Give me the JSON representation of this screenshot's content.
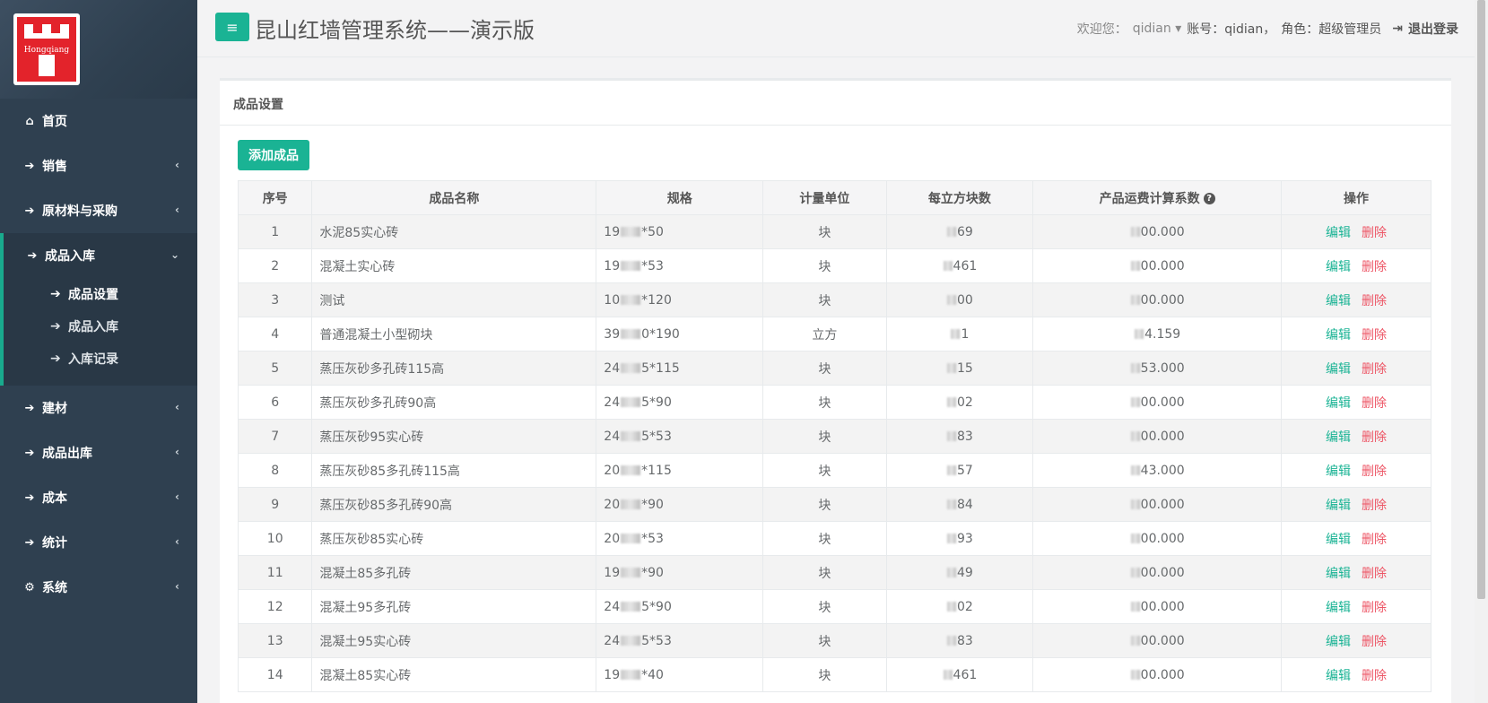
{
  "sidebar": {
    "logo_text": "Hongqiang",
    "items": [
      {
        "label": "首页",
        "icon": "home-icon"
      },
      {
        "label": "销售",
        "icon": "arrow-right-icon"
      },
      {
        "label": "原材料与采购",
        "icon": "arrow-right-icon"
      },
      {
        "label": "成品入库",
        "icon": "arrow-right-icon"
      },
      {
        "label": "建材",
        "icon": "arrow-right-icon"
      },
      {
        "label": "成品出库",
        "icon": "arrow-right-icon"
      },
      {
        "label": "成本",
        "icon": "arrow-right-icon"
      },
      {
        "label": "统计",
        "icon": "arrow-right-icon"
      },
      {
        "label": "系统",
        "icon": "gear-icon"
      }
    ],
    "sub_items": [
      {
        "label": "成品设置"
      },
      {
        "label": "成品入库"
      },
      {
        "label": "入库记录"
      }
    ]
  },
  "header": {
    "title": "昆山红墙管理系统——演示版",
    "welcome": "欢迎您：",
    "username": "qidian",
    "account": "账号：qidian，",
    "role": "角色：超级管理员",
    "logout": "退出登录"
  },
  "panel": {
    "title": "成品设置",
    "add_button": "添加成品"
  },
  "table": {
    "headers": [
      "序号",
      "成品名称",
      "规格",
      "计量单位",
      "每立方块数",
      "产品运费计算系数",
      "操作"
    ],
    "edit_label": "编辑",
    "delete_label": "删除",
    "rows": [
      {
        "no": "1",
        "name": "水泥85实心砖",
        "spec_a": "19",
        "spec_b": "*50",
        "unit": "块",
        "per_m3": "69",
        "coef": "00.000"
      },
      {
        "no": "2",
        "name": "混凝土实心砖",
        "spec_a": "19",
        "spec_b": "*53",
        "unit": "块",
        "per_m3": "461",
        "coef": "00.000"
      },
      {
        "no": "3",
        "name": "测试",
        "spec_a": "10",
        "spec_b": "*120",
        "unit": "块",
        "per_m3": "00",
        "coef": "00.000"
      },
      {
        "no": "4",
        "name": "普通混凝土小型砌块",
        "spec_a": "39",
        "spec_b": "0*190",
        "unit": "立方",
        "per_m3": "1",
        "coef": "4.159"
      },
      {
        "no": "5",
        "name": "蒸压灰砂多孔砖115高",
        "spec_a": "24",
        "spec_b": "5*115",
        "unit": "块",
        "per_m3": "15",
        "coef": "53.000"
      },
      {
        "no": "6",
        "name": "蒸压灰砂多孔砖90高",
        "spec_a": "24",
        "spec_b": "5*90",
        "unit": "块",
        "per_m3": "02",
        "coef": "00.000"
      },
      {
        "no": "7",
        "name": "蒸压灰砂95实心砖",
        "spec_a": "24",
        "spec_b": "5*53",
        "unit": "块",
        "per_m3": "83",
        "coef": "00.000"
      },
      {
        "no": "8",
        "name": "蒸压灰砂85多孔砖115高",
        "spec_a": "20",
        "spec_b": "*115",
        "unit": "块",
        "per_m3": "57",
        "coef": "43.000"
      },
      {
        "no": "9",
        "name": "蒸压灰砂85多孔砖90高",
        "spec_a": "20",
        "spec_b": "*90",
        "unit": "块",
        "per_m3": "84",
        "coef": "00.000"
      },
      {
        "no": "10",
        "name": "蒸压灰砂85实心砖",
        "spec_a": "20",
        "spec_b": "*53",
        "unit": "块",
        "per_m3": "93",
        "coef": "00.000"
      },
      {
        "no": "11",
        "name": "混凝土85多孔砖",
        "spec_a": "19",
        "spec_b": "*90",
        "unit": "块",
        "per_m3": "49",
        "coef": "00.000"
      },
      {
        "no": "12",
        "name": "混凝土95多孔砖",
        "spec_a": "24",
        "spec_b": "5*90",
        "unit": "块",
        "per_m3": "02",
        "coef": "00.000"
      },
      {
        "no": "13",
        "name": "混凝土95实心砖",
        "spec_a": "24",
        "spec_b": "5*53",
        "unit": "块",
        "per_m3": "83",
        "coef": "00.000"
      },
      {
        "no": "14",
        "name": "混凝土85实心砖",
        "spec_a": "19",
        "spec_b": "*40",
        "unit": "块",
        "per_m3": "461",
        "coef": "00.000"
      }
    ]
  }
}
